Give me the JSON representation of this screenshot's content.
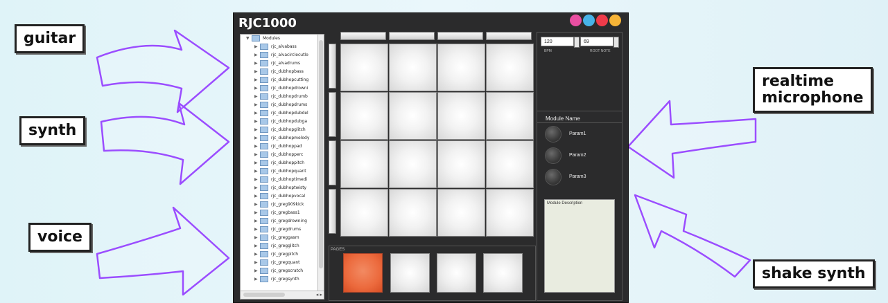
{
  "labels": {
    "guitar": "guitar",
    "synth": "synth",
    "voice": "voice",
    "realtime": "realtime\nmicrophone",
    "shake": "shake synth"
  },
  "app": {
    "title": "RJC1000",
    "tree": {
      "root": "Modules",
      "items": [
        "rjc_alvabass",
        "rjc_alvacirclecutlo",
        "rjc_alvadrums",
        "rjc_dubhopbass",
        "rjc_dubhopcutting",
        "rjc_dubhopdrowni",
        "rjc_dubhopdrumb",
        "rjc_dubhopdrums",
        "rjc_dubhopdubdel",
        "rjc_dubhopdubga",
        "rjc_dubhopglitch",
        "rjc_dubhopmelody",
        "rjc_dubhoppad",
        "rjc_dubhopperc",
        "rjc_dubhoppitch",
        "rjc_dubhopquant",
        "rjc_dubhoptimedi",
        "rjc_dubhoptwisty",
        "rjc_dubhopvocal",
        "rjc_greg909kick",
        "rjc_gregbass1",
        "rjc_gregdrowning",
        "rjc_gregdrums",
        "rjc_greggasm",
        "rjc_gregglitch",
        "rjc_gregpitch",
        "rjc_gregquant",
        "rjc_gregscratch",
        "rjc_gregsynth"
      ]
    },
    "pages_label": "PAGES",
    "bpm": {
      "value": "120",
      "label": "BPM"
    },
    "root_note": {
      "value": "69",
      "label": "ROOT NOTE"
    },
    "module": {
      "name": "Module Name",
      "params": [
        "Param1",
        "Param2",
        "Param3"
      ],
      "description": "Module Description"
    },
    "active_page_color": "#ec6a3d",
    "arrow_color": "#9b4dff"
  }
}
